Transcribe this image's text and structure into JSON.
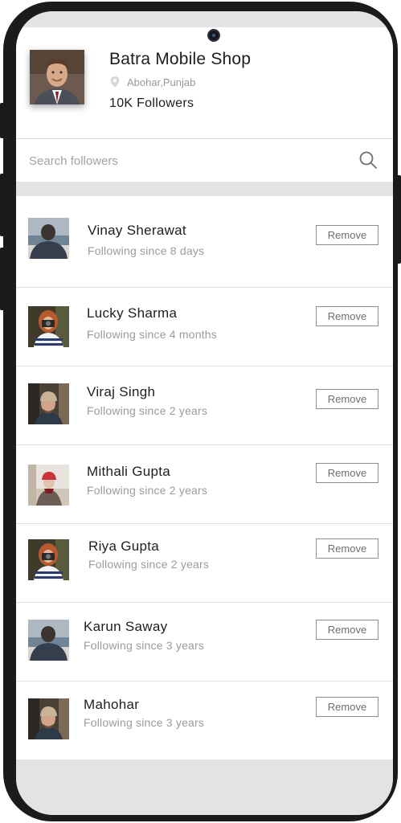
{
  "profile": {
    "shop_name": "Batra Mobile Shop",
    "location": "Abohar,Punjab",
    "followers": "10K Followers"
  },
  "search": {
    "placeholder": "Search followers"
  },
  "followers_list": [
    {
      "name": "Vinay Sherawat",
      "since": "Following since 8 days",
      "remove_label": "Remove",
      "avatar": "man-back-sea"
    },
    {
      "name": "Lucky Sharma",
      "since": "Following since 4 months",
      "remove_label": "Remove",
      "avatar": "woman-camera"
    },
    {
      "name": "Viraj Singh",
      "since": "Following since 2 years",
      "remove_label": "Remove",
      "avatar": "man-beanie"
    },
    {
      "name": "Mithali Gupta",
      "since": "Following since 2 years",
      "remove_label": "Remove",
      "avatar": "woman-red-hat"
    },
    {
      "name": "Riya Gupta",
      "since": "Following since 2 years",
      "remove_label": "Remove",
      "avatar": "woman-camera"
    },
    {
      "name": "Karun Saway",
      "since": "Following since 3 years",
      "remove_label": "Remove",
      "avatar": "man-back-sea"
    },
    {
      "name": "Mahohar",
      "since": "Following since 3 years",
      "remove_label": "Remove",
      "avatar": "man-beanie"
    }
  ],
  "colors": {
    "frame": "#1b1b1b",
    "band": "#e2e3e5",
    "text_primary": "#1d1d1d",
    "text_secondary": "#9b9b9b",
    "button_border": "#8d8d8d"
  }
}
